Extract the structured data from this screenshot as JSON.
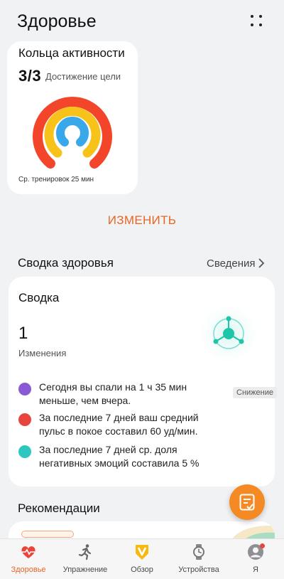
{
  "header": {
    "title": "Здоровье"
  },
  "activity_rings": {
    "title": "Кольца активности",
    "value": "3/3",
    "goal_label": "Достижение цели",
    "footer": "Ср. тренировок 25 мин",
    "ring_colors": [
      "#f2452a",
      "#f7c21a",
      "#39a8ea"
    ]
  },
  "edit_label": "ИЗМЕНИТЬ",
  "health_summary": {
    "section_title": "Сводка здоровья",
    "details_label": "Сведения",
    "card_title": "Сводка",
    "changes_count": "1",
    "changes_label": "Изменения",
    "insights": [
      {
        "icon": "sleep-icon",
        "color": "#8a5ad6",
        "text": "Сегодня вы спали на 1 ч 35 мин меньше, чем вчера.",
        "badge": "Снижение"
      },
      {
        "icon": "heart-icon",
        "color": "#e8453c",
        "text": "За последние 7 дней ваш средний пульс в покое составил 60 уд/мин."
      },
      {
        "icon": "emotion-icon",
        "color": "#2ec7c0",
        "text": "За последние 7 дней ср. доля негативных эмоций составила 5 %"
      }
    ]
  },
  "recommendations": {
    "title": "Рекомендации"
  },
  "accent_color": "#e56624",
  "tabs": [
    {
      "label": "Здоровье",
      "icon": "heart-pulse-icon",
      "active": true
    },
    {
      "label": "Упражнение",
      "icon": "running-icon",
      "active": false
    },
    {
      "label": "Обзор",
      "icon": "overview-v-icon",
      "active": false
    },
    {
      "label": "Устройства",
      "icon": "watch-icon",
      "active": false
    },
    {
      "label": "Я",
      "icon": "profile-icon",
      "active": false
    }
  ]
}
